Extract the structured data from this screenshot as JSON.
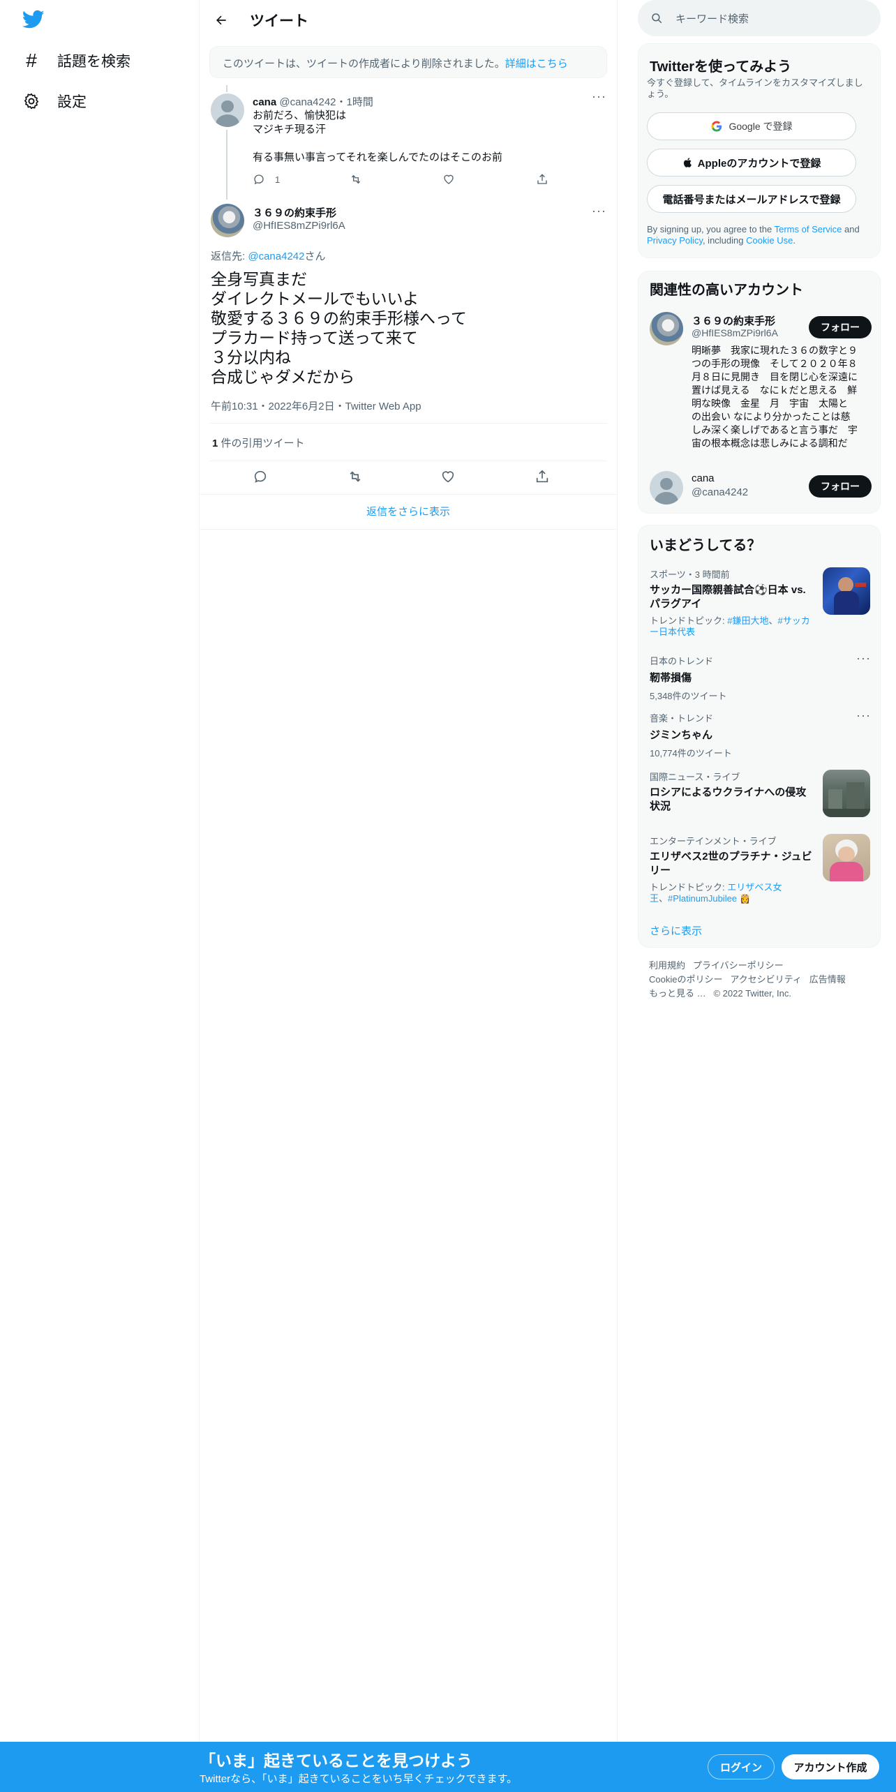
{
  "nav": {
    "explore_label": "話題を検索",
    "settings_label": "設定"
  },
  "header": {
    "title": "ツイート"
  },
  "deleted_notice": {
    "text": "このツイートは、ツイートの作成者により削除されました。",
    "link": "詳細はこちら"
  },
  "reply_tweet": {
    "name": "cana",
    "handle": "@cana4242",
    "sep": "・",
    "time": "1時間",
    "lines": [
      "お前だろ、愉快犯は",
      "マジキチ現る汗",
      "",
      "有る事無い事言ってそれを楽しんでたのはそこのお前"
    ],
    "reply_count": "1"
  },
  "main_tweet": {
    "name": "３６９の約束手形",
    "handle": "@HfIES8mZPi9rl6A",
    "reply_to_prefix": "返信先: ",
    "reply_to_handle": "@cana4242",
    "reply_to_suffix": "さん",
    "lines": [
      "全身写真まだ",
      "ダイレクトメールでもいいよ",
      "敬愛する３６９の約束手形様へって",
      "プラカード持って送って来て",
      "３分以内ね",
      "合成じゃダメだから"
    ],
    "timestamp": "午前10:31・2022年6月2日・Twitter Web App",
    "quote_count": "1",
    "quote_label": " 件の引用ツイート",
    "show_more": "返信をさらに表示"
  },
  "search": {
    "placeholder": "キーワード検索"
  },
  "signup": {
    "title": "Twitterを使ってみよう",
    "subtitle": "今すぐ登録して、タイムラインをカスタマイズしましょう。",
    "google": "Google で登録",
    "apple": "Appleのアカウントで登録",
    "phone": "電話番号またはメールアドレスで登録",
    "legal_1": "By signing up, you agree to the ",
    "tos": "Terms of Service",
    "legal_2": " and ",
    "privacy": "Privacy Policy",
    "legal_3": ", including ",
    "cookie": "Cookie Use",
    "legal_4": "."
  },
  "related": {
    "title": "関連性の高いアカウント",
    "follow": "フォロー",
    "accounts": [
      {
        "name": "３６９の約束手形",
        "handle": "@HfIES8mZPi9rl6A",
        "bio": [
          "明晰夢　我家に現れた３６の数字と９",
          "つの手形の現像　そして２０２０年８",
          "月８日に見開き　目を閉じ心を深遠に",
          "置けば見える　なにｋだと思える　鮮",
          "明な映像　金星　月　宇宙　太陽と",
          "の出会い なにより分かったことは慈",
          "しみ深く楽しげであると言う事だ　宇",
          "宙の根本概念は悲しみによる調和だ"
        ]
      },
      {
        "name": "cana",
        "handle": "@cana4242"
      }
    ]
  },
  "trends": {
    "title": "いまどうしてる？",
    "items": [
      {
        "meta": "スポーツ・3 時間前",
        "title_1": "サッカー国際親善試合⚽日本 vs.",
        "title_2": "パラグアイ",
        "topic_prefix": "トレンドトピック: ",
        "topic_1": "#鎌田大地",
        "topic_sep": "、",
        "topic_2": "#サッカ",
        "topic_3": "ー日本代表"
      },
      {
        "meta": "日本のトレンド",
        "title": "靭帯損傷",
        "count": "5,348件のツイート"
      },
      {
        "meta": "音楽・トレンド",
        "title": "ジミンちゃん",
        "count": "10,774件のツイート"
      },
      {
        "meta": "国際ニュース・ライブ",
        "title_1": "ロシアによるウクライナへの侵攻",
        "title_2": "状況"
      },
      {
        "meta": "エンターテインメント・ライブ",
        "title_1": "エリザベス2世のプラチナ・ジュビ",
        "title_2": "リー",
        "topic_prefix": "トレンドトピック: ",
        "topic_1": "エリザベス女",
        "topic_2": "王",
        "topic_sep": "、",
        "topic_3": "#PlatinumJubilee 👸"
      }
    ],
    "show_more": "さらに表示"
  },
  "footer": {
    "links": [
      "利用規約",
      "プライバシーポリシー",
      "Cookieのポリシー",
      "アクセシビリティ",
      "広告情報",
      "もっと見る …"
    ],
    "copyright": "© 2022 Twitter, Inc."
  },
  "bottom_bar": {
    "title": "「いま」起きていることを見つけよう",
    "subtitle": "Twitterなら、「いま」起きていることをいち早くチェックできます。",
    "login": "ログイン",
    "signup": "アカウント作成"
  },
  "colors": {
    "brand": "#1d9bf0",
    "text": "#0f1419",
    "muted": "#536471"
  }
}
